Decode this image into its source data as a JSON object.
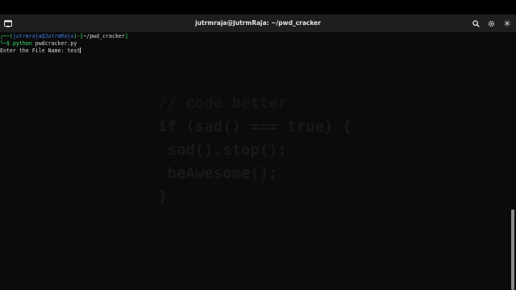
{
  "window": {
    "title": "jutrmraja@JutrmRaja: ~/pwd_cracker",
    "icons": [
      "terminal-icon",
      "search-icon",
      "gear-icon",
      "close-icon"
    ]
  },
  "terminal": {
    "prompt_open": "┌──(",
    "user_host": "jutrmraja@JutrmRaja",
    "prompt_mid": ")-[",
    "cwd": "~/pwd_cracker",
    "prompt_close": "]",
    "prompt2": "└─$",
    "command": "python",
    "command_arg": "pwdcracker.py",
    "input_prompt": "Enter the File Name: ",
    "input_value": "test"
  },
  "wallpaper": {
    "lines": [
      "// code better",
      "if (sad() === true) {",
      " sad().stop();",
      " beAwesome();",
      "}"
    ]
  },
  "colors": {
    "prompt_blue": "#3b7ae0",
    "prompt_green": "#3ee06e",
    "titlebar": "#1e1e1e",
    "terminal_bg": "#0b0b0b"
  }
}
